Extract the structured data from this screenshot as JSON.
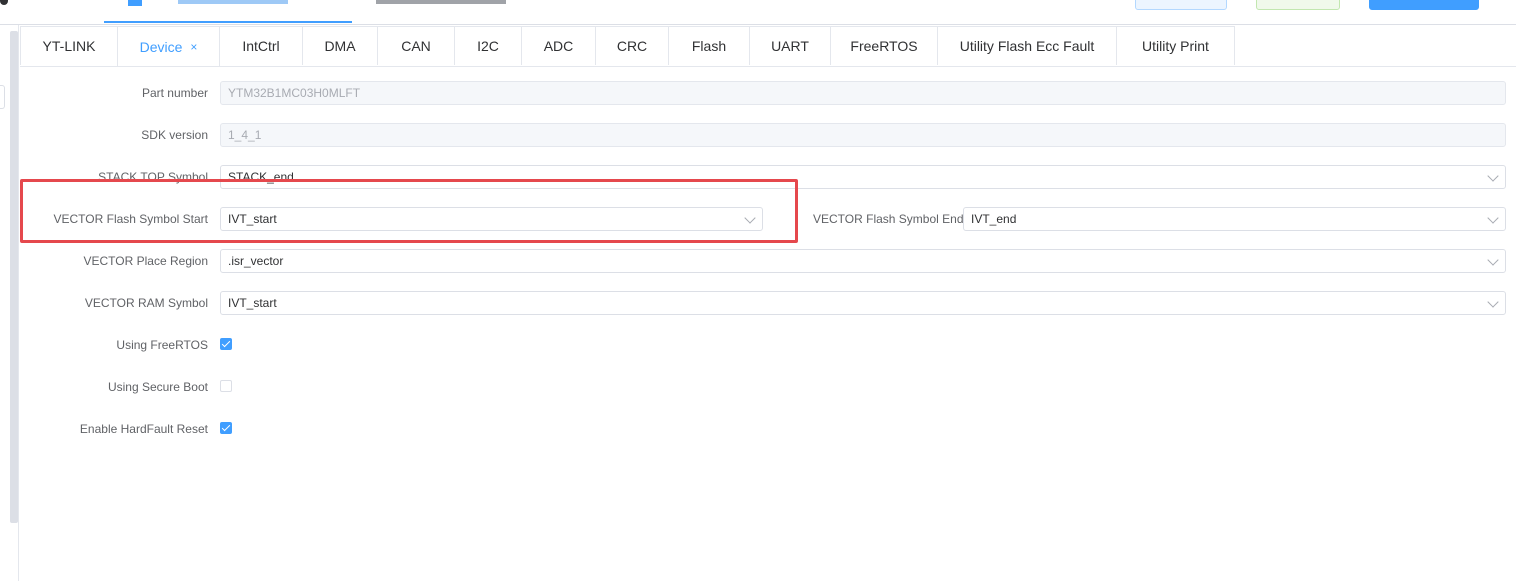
{
  "tabs": [
    {
      "label": "YT-LINK",
      "active": false
    },
    {
      "label": "Device",
      "active": true,
      "close": "×"
    },
    {
      "label": "IntCtrl",
      "active": false
    },
    {
      "label": "DMA",
      "active": false
    },
    {
      "label": "CAN",
      "active": false
    },
    {
      "label": "I2C",
      "active": false
    },
    {
      "label": "ADC",
      "active": false
    },
    {
      "label": "CRC",
      "active": false
    },
    {
      "label": "Flash",
      "active": false
    },
    {
      "label": "UART",
      "active": false
    },
    {
      "label": "FreeRTOS",
      "active": false
    },
    {
      "label": "Utility Flash Ecc Fault",
      "active": false
    },
    {
      "label": "Utility Print",
      "active": false
    }
  ],
  "form": {
    "part_number": {
      "label": "Part number",
      "value": "YTM32B1MC03H0MLFT"
    },
    "sdk_version": {
      "label": "SDK version",
      "value": "1_4_1"
    },
    "stack_top": {
      "label": "STACK TOP Symbol",
      "value": "STACK_end"
    },
    "vector_flash_start": {
      "label": "VECTOR Flash Symbol Start",
      "value": "IVT_start"
    },
    "vector_flash_end": {
      "label": "VECTOR Flash Symbol End",
      "value": "IVT_end"
    },
    "vector_place_region": {
      "label": "VECTOR Place Region",
      "value": ".isr_vector"
    },
    "vector_ram_symbol": {
      "label": "VECTOR RAM Symbol",
      "value": "IVT_start"
    },
    "using_freertos": {
      "label": "Using FreeRTOS",
      "checked": true
    },
    "using_secure_boot": {
      "label": "Using Secure Boot",
      "checked": false
    },
    "enable_hardfault_reset": {
      "label": "Enable HardFault Reset",
      "checked": true
    }
  },
  "colors": {
    "accent": "#409eff",
    "highlight": "#e5484d"
  }
}
